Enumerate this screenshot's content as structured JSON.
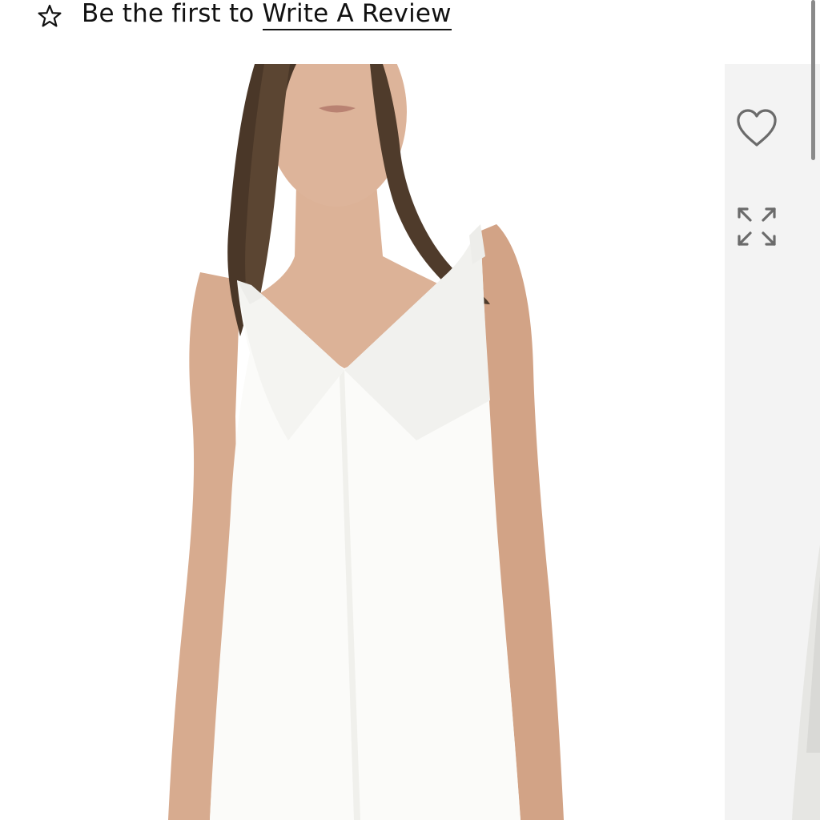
{
  "review": {
    "prefix": "Be the first to",
    "link_label": "Write A Review"
  },
  "icons": {
    "rating": "star-outline-icon",
    "wishlist": "heart-outline-icon",
    "expand": "expand-arrows-icon"
  },
  "colors": {
    "text": "#111111",
    "icon": "#6b6b6b",
    "strip_background": "#f3f3f3",
    "dress": "#fbfbf9",
    "hair": "#4a3728",
    "skin": "#d7ab8f"
  }
}
